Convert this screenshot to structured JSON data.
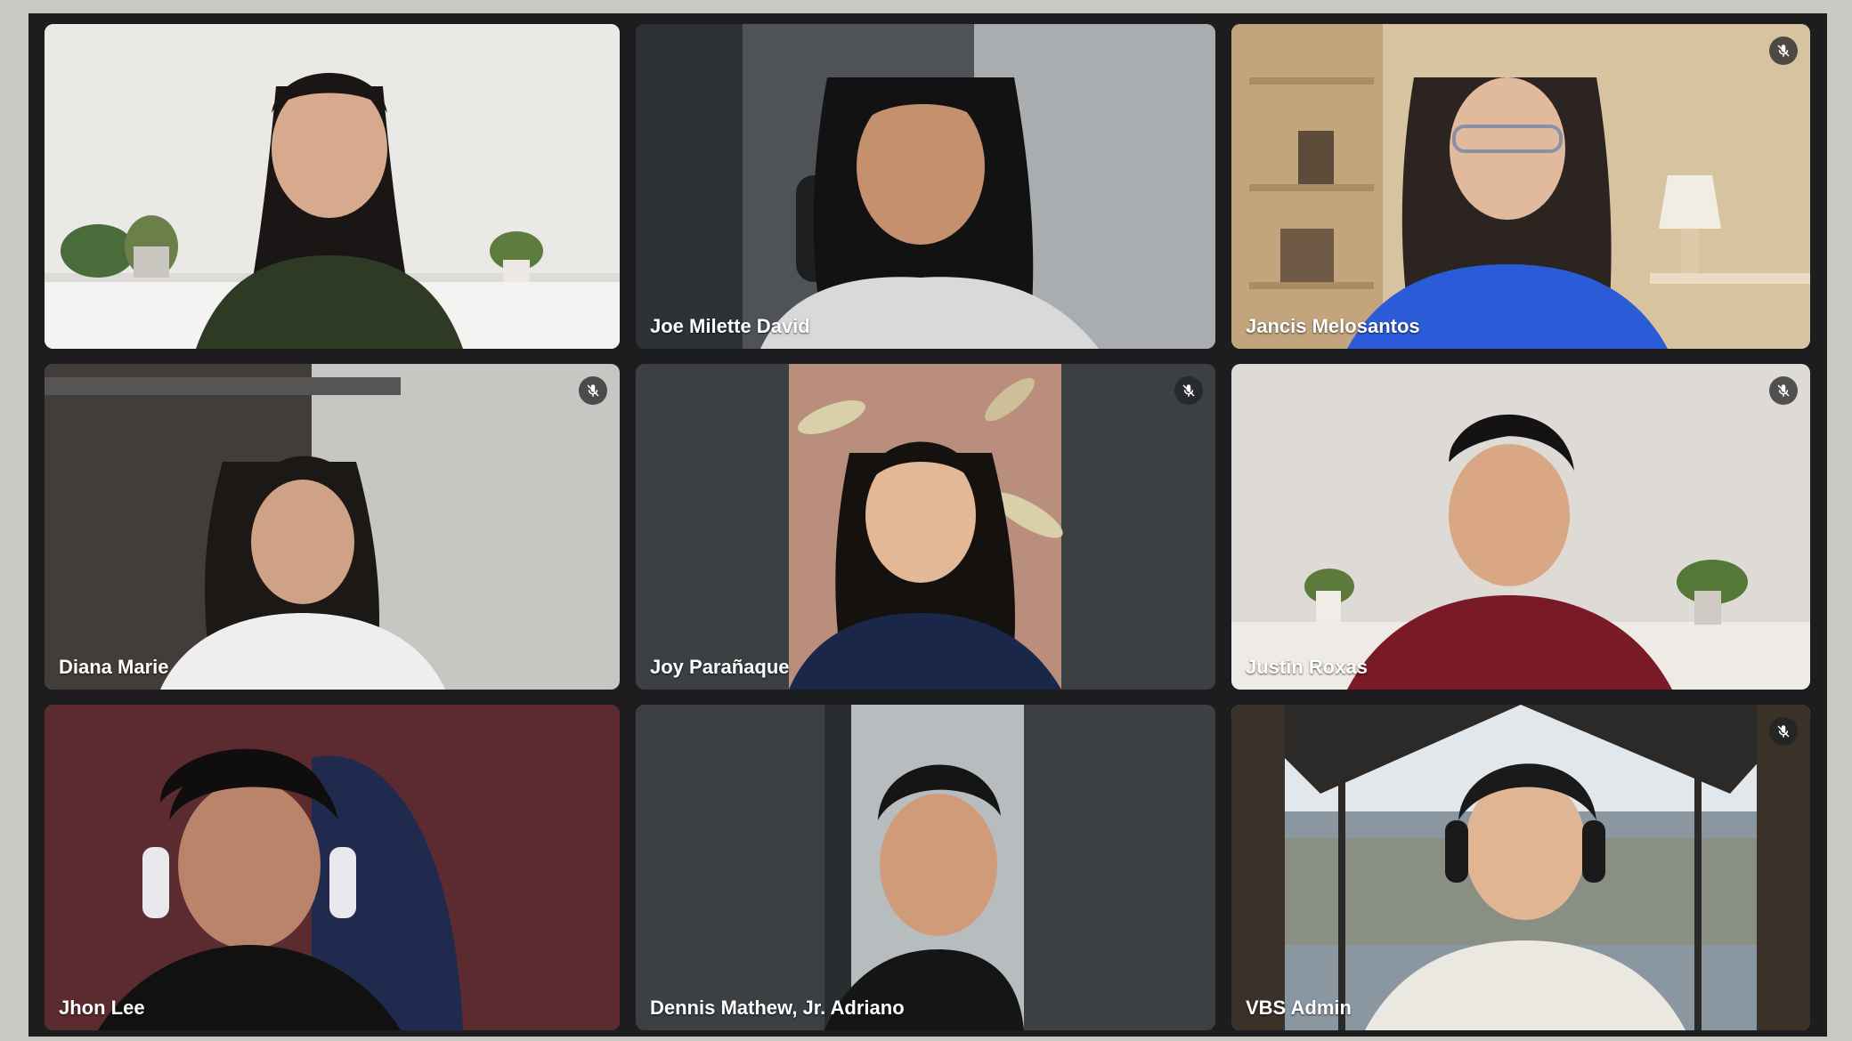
{
  "participants": [
    {
      "name": "",
      "muted": false,
      "bg": "#e7e4df"
    },
    {
      "name": "Joe Milette David",
      "muted": false,
      "bg": "#4f5357"
    },
    {
      "name": "Jancis Melosantos",
      "muted": true,
      "bg": "#d9c6a3"
    },
    {
      "name": "Diana Marie",
      "muted": true,
      "bg": "#b3b3b0"
    },
    {
      "name": "Joy Parañaque",
      "muted": true,
      "bg": "#3c4043"
    },
    {
      "name": "Justin Roxas",
      "muted": true,
      "bg": "#dcd9d3"
    },
    {
      "name": "Jhon Lee",
      "muted": false,
      "bg": "#5b2b30"
    },
    {
      "name": "Dennis Mathew, Jr. Adriano",
      "muted": false,
      "bg": "#3c4043"
    },
    {
      "name": "VBS Admin",
      "muted": true,
      "bg": "#6f7a80"
    }
  ],
  "colors": {
    "tile_empty": "#3c4043",
    "frame": "#1d1d1f",
    "name_text": "#ffffff"
  },
  "icons": {
    "mute": "mic-off-icon"
  }
}
